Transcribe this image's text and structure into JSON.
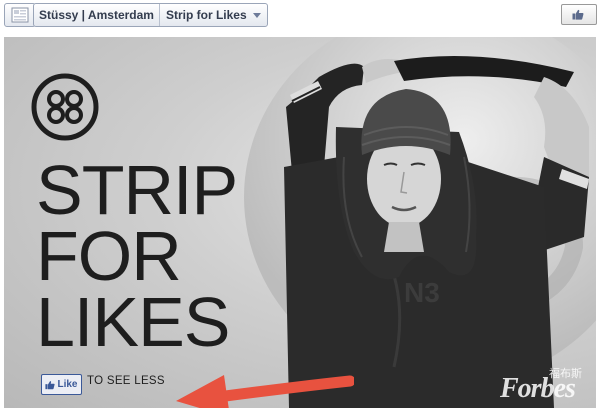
{
  "breadcrumb": {
    "page_name": "Stüssy | Amsterdam",
    "tab_name": "Strip for Likes"
  },
  "topbar": {
    "like_label": ""
  },
  "banner": {
    "headline_lines": [
      "STRIP",
      "FOR",
      "LIKES"
    ],
    "like_button_label": "Like",
    "cta_text": "TO SEE LESS",
    "watermark": "Forbes",
    "watermark_cn": "福布斯",
    "jersey_text": "N3"
  },
  "colors": {
    "facebook_blue": "#3b5998",
    "arrow_red": "#e8523f",
    "headline": "#1e1e1e"
  },
  "icons": [
    "page-icon",
    "chevron-down-icon",
    "thumbs-up-icon",
    "stussy-logo",
    "arrow-icon"
  ]
}
